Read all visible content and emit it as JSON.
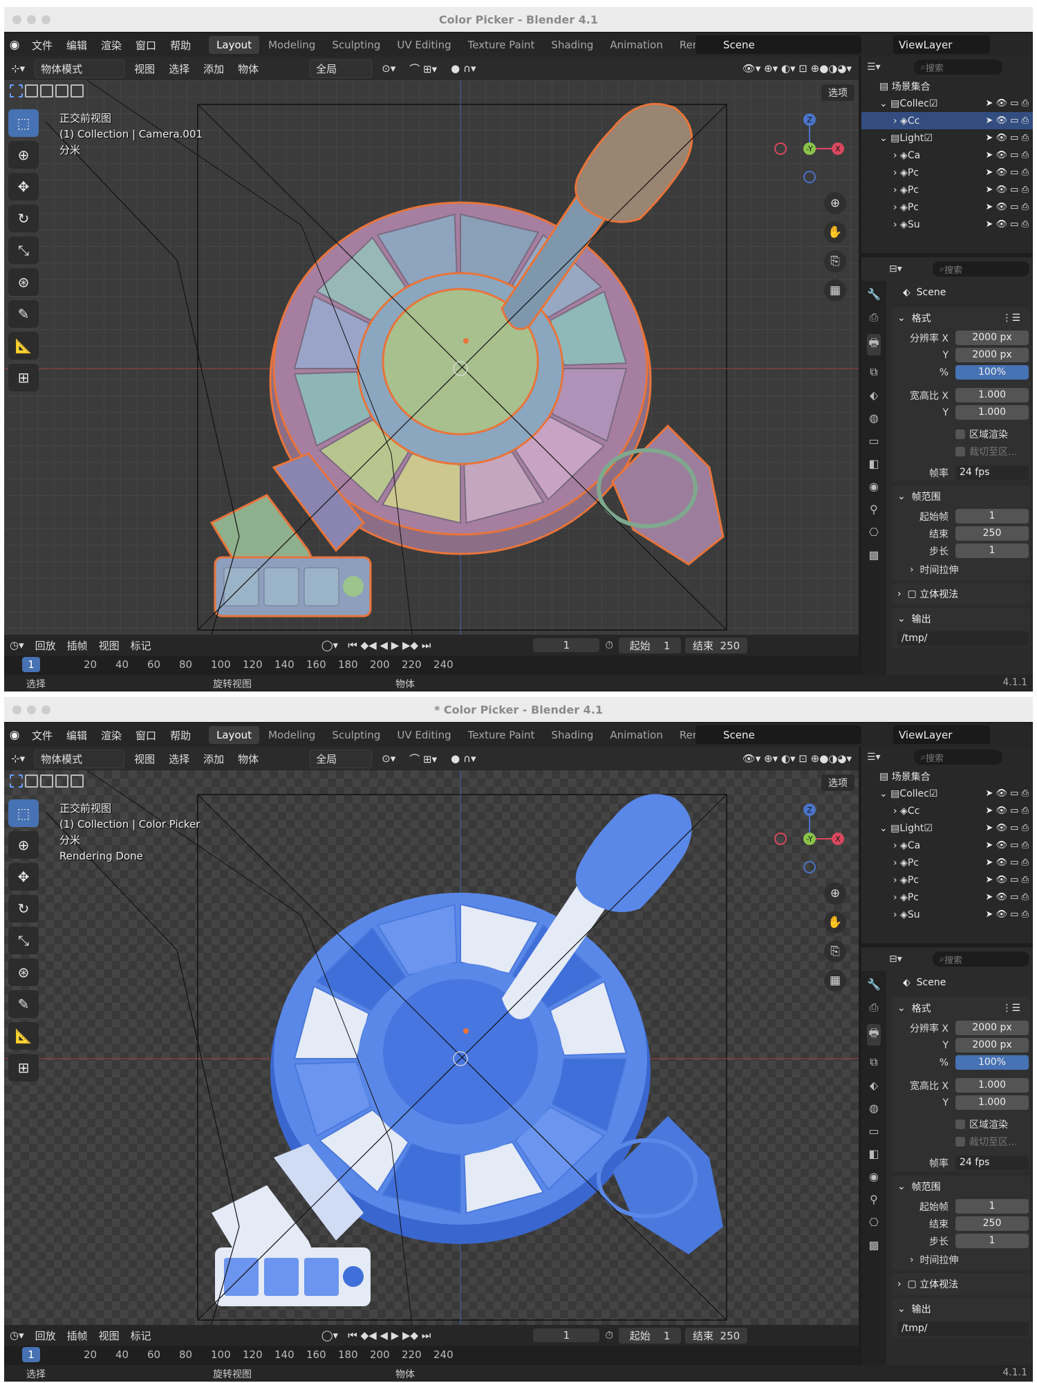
{
  "windows": [
    {
      "title": "Color Picker - Blender 4.1",
      "menu": [
        "文件",
        "编辑",
        "渲染",
        "窗口",
        "帮助"
      ],
      "workspaces": [
        "Layout",
        "Modeling",
        "Sculpting",
        "UV Editing",
        "Texture Paint",
        "Shading",
        "Animation",
        "Rendering"
      ],
      "active_workspace": "Layout",
      "scene": "Scene",
      "view_layer": "ViewLayer",
      "header": {
        "mode": "物体模式",
        "view": "视图",
        "select": "选择",
        "add": "添加",
        "object": "物体",
        "orientation": "全局",
        "options": "选项"
      },
      "overlay": {
        "view_name": "正交前视图",
        "collection": "(1) Collection | Camera.001",
        "units": "分米",
        "status": ""
      },
      "timeline": {
        "playback": "回放",
        "keying": "插帧",
        "view": "视图",
        "marker": "标记",
        "current_frame": "1",
        "start_label": "起始",
        "start": "1",
        "end_label": "结束",
        "end": "250",
        "cursor": "1",
        "ticks": [
          "20",
          "40",
          "60",
          "80",
          "100",
          "120",
          "140",
          "160",
          "180",
          "200",
          "220",
          "240"
        ]
      },
      "statusbar": {
        "select": "选择",
        "rotate": "旋转视图",
        "object": "物体",
        "version": "4.1.1"
      },
      "outliner": {
        "search": "搜索",
        "root": "场景集合",
        "rows": [
          {
            "label": "Collec",
            "indent": 1,
            "checked": true,
            "selected": false
          },
          {
            "label": "Cc",
            "indent": 2,
            "checked": false,
            "selected": true
          },
          {
            "label": "Light",
            "indent": 1,
            "checked": true,
            "selected": false
          },
          {
            "label": "Ca",
            "indent": 2,
            "checked": false,
            "selected": false
          },
          {
            "label": "Pc",
            "indent": 2,
            "checked": false,
            "selected": false
          },
          {
            "label": "Pc",
            "indent": 2,
            "checked": false,
            "selected": false
          },
          {
            "label": "Pc",
            "indent": 2,
            "checked": false,
            "selected": false
          },
          {
            "label": "Su",
            "indent": 2,
            "checked": false,
            "selected": false
          }
        ]
      },
      "properties": {
        "search": "搜索",
        "scene": "Scene",
        "format_label": "格式",
        "res_x_label": "分辨率 X",
        "res_x": "2000 px",
        "res_y_label": "Y",
        "res_y": "2000 px",
        "pct_label": "%",
        "pct": "100%",
        "aspect_x_label": "宽高比 X",
        "aspect_x": "1.000",
        "aspect_y_label": "Y",
        "aspect_y": "1.000",
        "region": "区域渲染",
        "crop": "裁切至区...",
        "fps_label": "帧率",
        "fps": "24 fps",
        "frame_range_label": "帧范围",
        "start_label": "起始帧",
        "start": "1",
        "end_label": "结束",
        "end": "250",
        "step_label": "步长",
        "step": "1",
        "time_stretch": "时间拉伸",
        "stereo": "立体视法",
        "output": "输出",
        "path": "/tmp/"
      }
    },
    {
      "title": "* Color Picker - Blender 4.1",
      "menu": [
        "文件",
        "编辑",
        "渲染",
        "窗口",
        "帮助"
      ],
      "workspaces": [
        "Layout",
        "Modeling",
        "Sculpting",
        "UV Editing",
        "Texture Paint",
        "Shading",
        "Animation",
        "Rendering"
      ],
      "active_workspace": "Layout",
      "scene": "Scene",
      "view_layer": "ViewLayer",
      "header": {
        "mode": "物体模式",
        "view": "视图",
        "select": "选择",
        "add": "添加",
        "object": "物体",
        "orientation": "全局",
        "options": "选项"
      },
      "overlay": {
        "view_name": "正交前视图",
        "collection": "(1) Collection | Color Picker",
        "units": "分米",
        "status": "Rendering Done"
      },
      "timeline": {
        "playback": "回放",
        "keying": "插帧",
        "view": "视图",
        "marker": "标记",
        "current_frame": "1",
        "start_label": "起始",
        "start": "1",
        "end_label": "结束",
        "end": "250",
        "cursor": "1",
        "ticks": [
          "20",
          "40",
          "60",
          "80",
          "100",
          "120",
          "140",
          "160",
          "180",
          "200",
          "220",
          "240"
        ]
      },
      "statusbar": {
        "select": "选择",
        "rotate": "旋转视图",
        "object": "物体",
        "version": "4.1.1"
      },
      "outliner": {
        "search": "搜索",
        "root": "场景集合",
        "rows": [
          {
            "label": "Collec",
            "indent": 1,
            "checked": true,
            "selected": false
          },
          {
            "label": "Cc",
            "indent": 2,
            "checked": false,
            "selected": false
          },
          {
            "label": "Light",
            "indent": 1,
            "checked": true,
            "selected": false
          },
          {
            "label": "Ca",
            "indent": 2,
            "checked": false,
            "selected": false
          },
          {
            "label": "Pc",
            "indent": 2,
            "checked": false,
            "selected": false
          },
          {
            "label": "Pc",
            "indent": 2,
            "checked": false,
            "selected": false
          },
          {
            "label": "Pc",
            "indent": 2,
            "checked": false,
            "selected": false
          },
          {
            "label": "Su",
            "indent": 2,
            "checked": false,
            "selected": false
          }
        ]
      },
      "properties": {
        "search": "搜索",
        "scene": "Scene",
        "format_label": "格式",
        "res_x_label": "分辨率 X",
        "res_x": "2000 px",
        "res_y_label": "Y",
        "res_y": "2000 px",
        "pct_label": "%",
        "pct": "100%",
        "aspect_x_label": "宽高比 X",
        "aspect_x": "1.000",
        "aspect_y_label": "Y",
        "aspect_y": "1.000",
        "region": "区域渲染",
        "crop": "裁切至区...",
        "fps_label": "帧率",
        "fps": "24 fps",
        "frame_range_label": "帧范围",
        "start_label": "起始帧",
        "start": "1",
        "end_label": "结束",
        "end": "250",
        "step_label": "步长",
        "step": "1",
        "time_stretch": "时间拉伸",
        "stereo": "立体视法",
        "output": "输出",
        "path": "/tmp/"
      }
    }
  ],
  "colors": {
    "accent": "#4772b3",
    "selection_outline": "#e8743a",
    "render_blue": "#4f7fe0",
    "render_light": "#e4eaf6"
  }
}
